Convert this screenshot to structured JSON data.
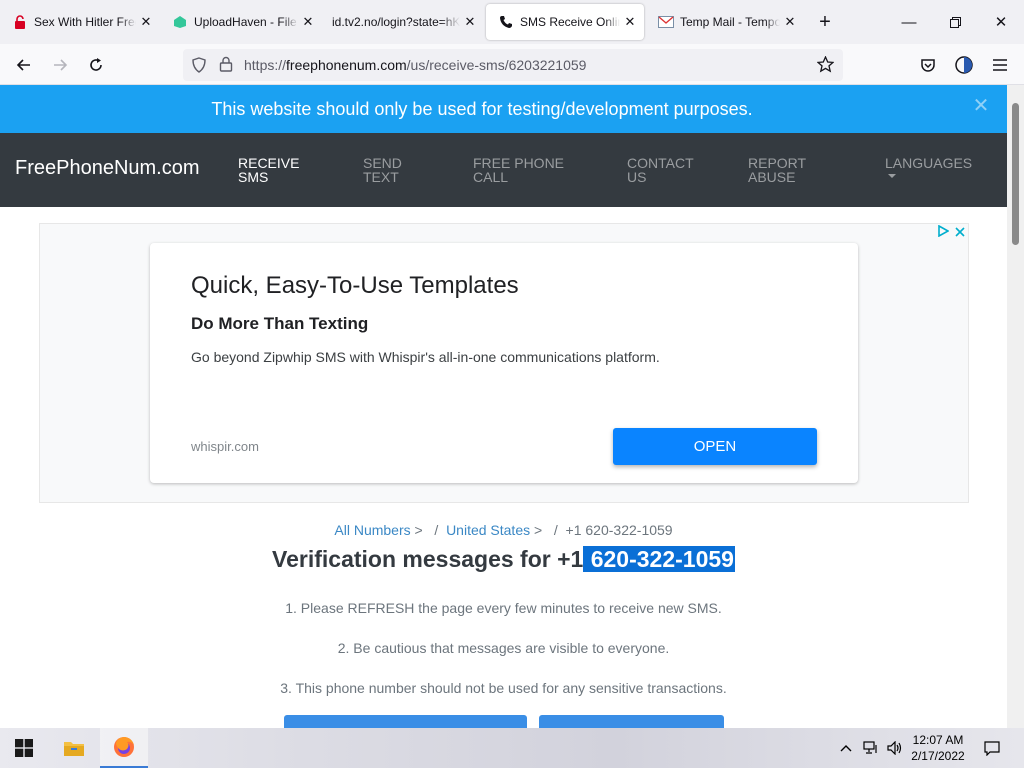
{
  "browser": {
    "tabs": [
      {
        "label": "Sex With Hitler Free",
        "icon": "lock-red-icon"
      },
      {
        "label": "UploadHaven - File",
        "icon": "uploadhaven-icon"
      },
      {
        "label": "id.tv2.no/login?state=hKF",
        "icon": "none"
      },
      {
        "label": "SMS Receive Online",
        "icon": "phone-icon",
        "active": true
      },
      {
        "label": "Temp Mail - Tempor",
        "icon": "mail-icon"
      }
    ],
    "url_prefix": "https://",
    "url_host": "freephonenum.com",
    "url_path": "/us/receive-sms/6203221059"
  },
  "alert": {
    "text": "This website should only be used for testing/development purposes.",
    "color": "#1ba1f2"
  },
  "site_nav": {
    "brand": "FreePhoneNum.com",
    "items": [
      {
        "label": "Receive SMS"
      },
      {
        "label": "Send Text"
      },
      {
        "label": "Free Phone Call"
      },
      {
        "label": "Contact Us"
      },
      {
        "label": "Report Abuse"
      },
      {
        "label": "Languages"
      }
    ]
  },
  "ad": {
    "title": "Quick, Easy-To-Use Templates",
    "subtitle": "Do More Than Texting",
    "body": "Go beyond Zipwhip SMS with Whispir's all-in-one communications platform.",
    "domain": "whispir.com",
    "cta": "OPEN"
  },
  "breadcrumb": {
    "all_numbers": "All Numbers",
    "sep1": ">",
    "slash1": "/",
    "country": "United States",
    "sep2": ">",
    "slash2": "/",
    "current": "+1 620-322-1059"
  },
  "heading": {
    "prefix": "Verification messages for +1",
    "number": " 620-322-1059"
  },
  "notes": [
    "1. Please REFRESH the page every few minutes to receive new SMS.",
    "2. Be cautious that messages are visible to everyone.",
    "3. This phone number should not be used for any sensitive transactions."
  ],
  "taskbar": {
    "time": "12:07 AM",
    "date": "2/17/2022"
  }
}
